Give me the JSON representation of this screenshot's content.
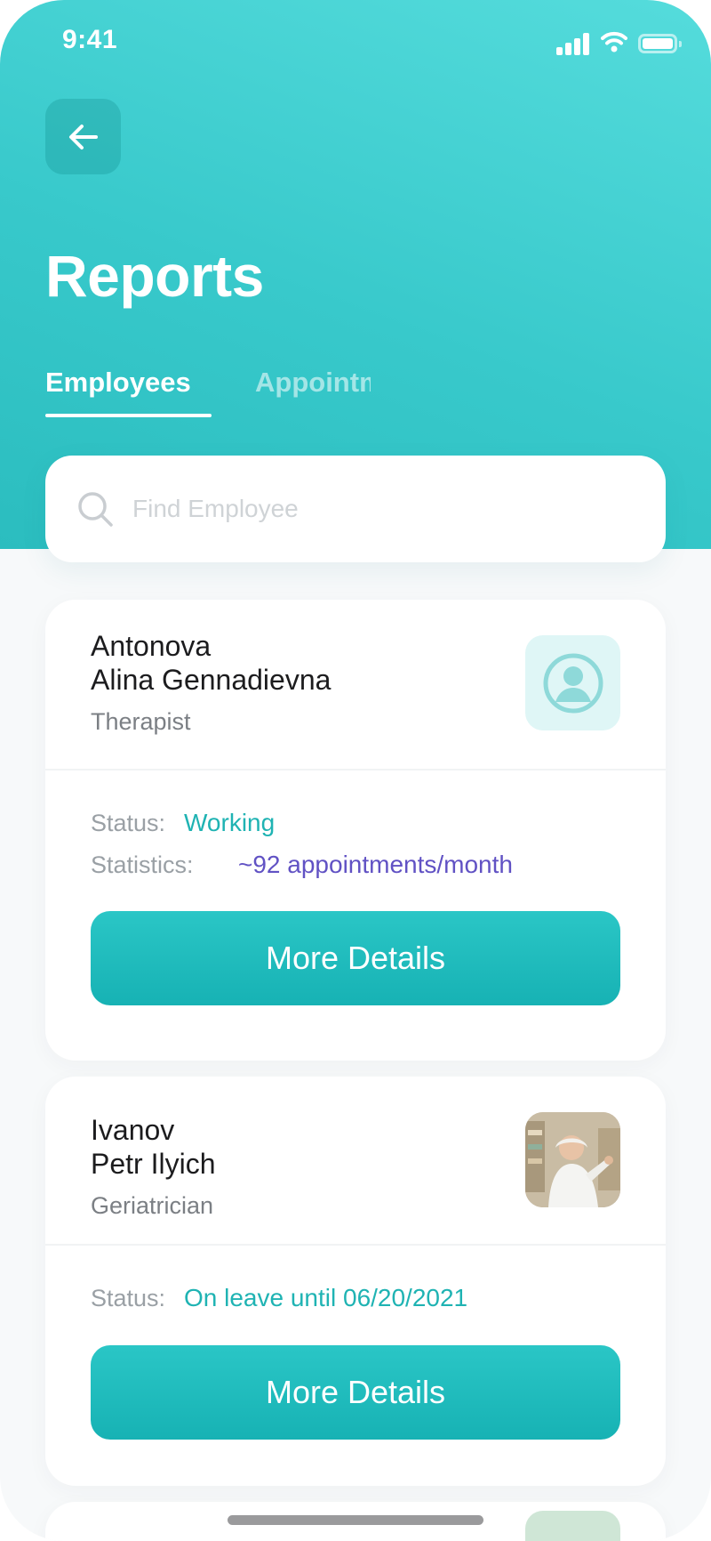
{
  "status_bar": {
    "time": "9:41"
  },
  "header": {
    "title": "Reports",
    "tabs": [
      {
        "label": "Employees",
        "active": true
      },
      {
        "label": "Appointments",
        "active": false
      }
    ]
  },
  "search": {
    "placeholder": "Find Employee",
    "value": ""
  },
  "employees": [
    {
      "last_name": "Antonova",
      "first_names": "Alina Gennadievna",
      "role": "Therapist",
      "avatar": "user-placeholder-icon",
      "status_label": "Status:",
      "status_value": "Working",
      "stats_label": "Statistics:",
      "stats_value": "~92 appointments/month",
      "button_label": "More Details"
    },
    {
      "last_name": "Ivanov",
      "first_names": "Petr Ilyich",
      "role": "Geriatrician",
      "avatar": "employee-photo",
      "status_label": "Status:",
      "status_value": "On leave until 06/20/2021",
      "button_label": "More Details"
    }
  ],
  "colors": {
    "accent": "#2bc4c5",
    "status_value": "#1fb3b3",
    "statistics_value": "#6152c4"
  }
}
